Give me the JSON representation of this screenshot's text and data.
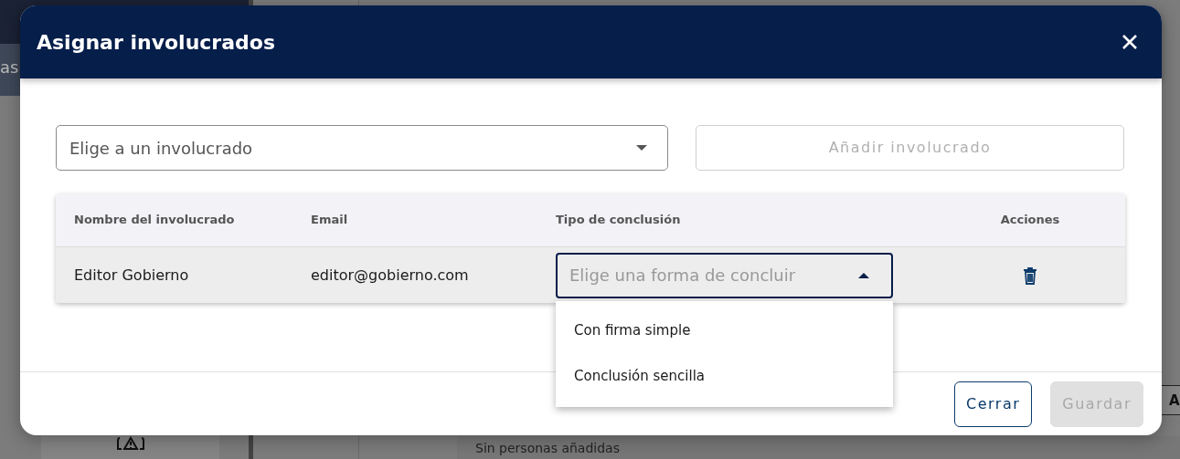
{
  "background": {
    "sidebar_fragment": "as",
    "right_button_fragment": "A",
    "empty_message": "Sin personas añadidas"
  },
  "dialog": {
    "title": "Asignar involucrados",
    "involved_select": {
      "placeholder": "Elige a un involucrado"
    },
    "add_button": {
      "label": "Añadir involucrado",
      "disabled": true
    },
    "table": {
      "columns": [
        "Nombre del involucrado",
        "Email",
        "Tipo de conclusión",
        "Acciones"
      ],
      "rows": [
        {
          "name": "Editor Gobierno",
          "email": "editor@gobierno.com",
          "conclusion": {
            "placeholder": "Elige una forma de concluir",
            "expanded": true,
            "options": [
              "Con firma simple",
              "Conclusión sencilla"
            ]
          }
        }
      ]
    },
    "buttons": [
      {
        "label": "Cerrar",
        "disabled": false
      },
      {
        "label": "Guardar",
        "disabled": true
      }
    ]
  }
}
